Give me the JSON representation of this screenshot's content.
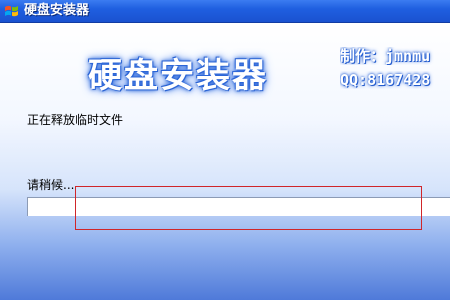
{
  "window": {
    "title": "硬盘安装器",
    "icon": "windows-flag-icon"
  },
  "banner": {
    "title": "硬盘安装器",
    "author": "制作：jmnmu",
    "qq": "QQ:8167428"
  },
  "status": {
    "message": "正在释放临时文件",
    "wait_label": "请稍候..."
  },
  "progress": {
    "value": 0
  },
  "colors": {
    "titlebar": "#1f5fe0",
    "highlight_border": "#d0262a",
    "progress_fill": "#3fb83a"
  }
}
